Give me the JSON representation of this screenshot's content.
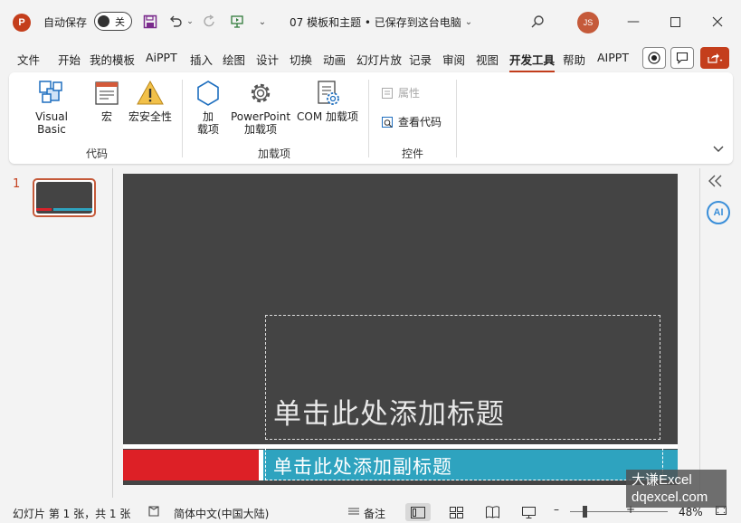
{
  "titlebar": {
    "app_logo": "P",
    "autosave_label": "自动保存",
    "autosave_state": "关",
    "doc_title": "07 模板和主题 • 已保存到这台电脑",
    "avatar_initials": "JS"
  },
  "menu": {
    "tabs": [
      "文件",
      "开始",
      "我的模板",
      "AiPPT",
      "插入",
      "绘图",
      "设计",
      "切换",
      "动画",
      "幻灯片放",
      "记录",
      "审阅",
      "视图",
      "开发工具",
      "帮助",
      "AIPPT"
    ],
    "active_tab": "开发工具"
  },
  "ribbon": {
    "code_group": {
      "label": "代码",
      "visual_basic": "Visual Basic",
      "macros": "宏",
      "macro_security": "宏安全性"
    },
    "addins_group": {
      "label": "加载项",
      "addins_line1": "加",
      "addins_line2": "载项",
      "ppt_addins_line1": "PowerPoint",
      "ppt_addins_line2": "加载项",
      "com_addins": "COM 加载项"
    },
    "controls_group": {
      "label": "控件",
      "properties": "属性",
      "view_code": "查看代码"
    }
  },
  "slide_pane": {
    "slide_number": "1"
  },
  "slide": {
    "title_placeholder": "单击此处添加标题",
    "subtitle_placeholder": "单击此处添加副标题",
    "colors": {
      "background": "#444444",
      "red_bar": "#dd2026",
      "teal_bar": "#2ea3bf"
    }
  },
  "side_pane": {
    "ai_badge": "AI"
  },
  "statusbar": {
    "slide_info": "幻灯片 第 1 张，共 1 张",
    "language": "简体中文(中国大陆)",
    "notes": "备注",
    "zoom": "48%"
  },
  "watermark": {
    "line1": "大谦Excel",
    "line2": "dqexcel.com"
  },
  "accent_color": "#c43e1c"
}
